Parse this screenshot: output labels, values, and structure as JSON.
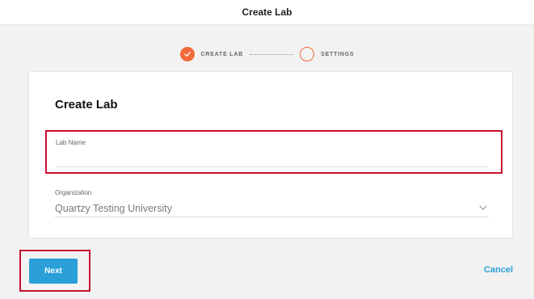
{
  "header": {
    "title": "Create Lab"
  },
  "stepper": {
    "steps": [
      {
        "label": "CREATE LAB",
        "status": "completed",
        "icon": "check-icon"
      },
      {
        "label": "SETTINGS",
        "status": "pending"
      }
    ],
    "accent_color": "#f26b3a"
  },
  "card": {
    "title": "Create Lab",
    "lab_name": {
      "label": "Lab Name",
      "value": ""
    },
    "organization": {
      "label": "Organization",
      "value": "Quartzy Testing University",
      "icon": "chevron-down-icon"
    }
  },
  "footer": {
    "next_label": "Next",
    "cancel_label": "Cancel",
    "primary_color": "#2a9fd8"
  },
  "highlight_color": "#c8102e"
}
